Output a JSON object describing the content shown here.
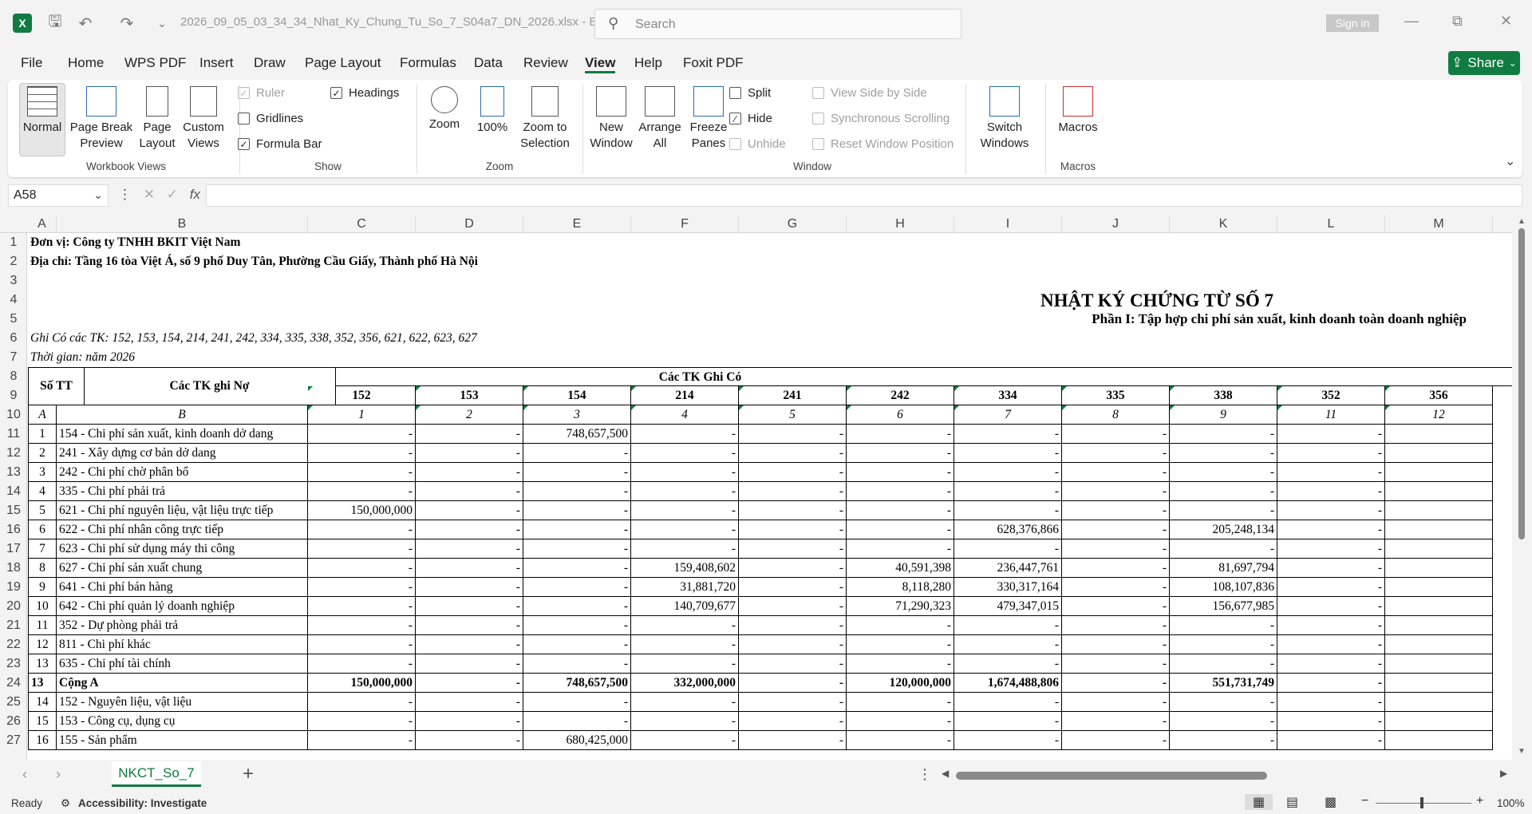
{
  "titlebar": {
    "filename": "2026_09_05_03_34_34_Nhat_Ky_Chung_Tu_So_7_S04a7_DN_2026.xlsx  -  E...",
    "search_placeholder": "Search",
    "signin": "Sign in"
  },
  "menu": [
    "File",
    "Home",
    "WPS PDF",
    "Insert",
    "Draw",
    "Page Layout",
    "Formulas",
    "Data",
    "Review",
    "View",
    "Help",
    "Foxit PDF"
  ],
  "active_menu": "View",
  "share_label": "Share",
  "ribbon": {
    "workbook_views": {
      "label": "Workbook Views",
      "items": [
        "Normal",
        "Page Break Preview",
        "Page Layout",
        "Custom Views"
      ]
    },
    "show": {
      "label": "Show",
      "ruler": "Ruler",
      "gridlines": "Gridlines",
      "formula_bar": "Formula Bar",
      "headings": "Headings"
    },
    "zoom": {
      "label": "Zoom",
      "items": [
        "Zoom",
        "100%",
        "Zoom to Selection"
      ]
    },
    "window": {
      "label": "Window",
      "new_window": "New Window",
      "arrange_all": "Arrange All",
      "freeze_panes": "Freeze Panes",
      "split": "Split",
      "hide": "Hide",
      "unhide": "Unhide",
      "view_side_by_side": "View Side by Side",
      "sync_scrolling": "Synchronous Scrolling",
      "reset_position": "Reset Window Position",
      "switch_windows": "Switch Windows"
    },
    "macros": {
      "label": "Macros",
      "item": "Macros"
    }
  },
  "formula_bar": {
    "name_box": "A58",
    "fx": "fx",
    "value": ""
  },
  "columns": [
    "A",
    "B",
    "C",
    "D",
    "E",
    "F",
    "G",
    "H",
    "I",
    "J",
    "K",
    "L",
    "M"
  ],
  "rows": [
    "1",
    "2",
    "3",
    "4",
    "5",
    "6",
    "7",
    "8",
    "9",
    "10",
    "11",
    "12",
    "13",
    "14",
    "15",
    "16",
    "17",
    "18",
    "19",
    "20",
    "21",
    "22",
    "23",
    "24",
    "25",
    "26",
    "27"
  ],
  "sheet": {
    "unit": "Đơn vị: Công ty TNHH BKIT Việt Nam",
    "address": "Địa chỉ: Tầng 16 tòa Việt Á, số 9 phố Duy Tân, Phường Cầu Giấy, Thành phố Hà Nội",
    "title": "NHẬT KÝ CHỨNG TỪ SỐ 7",
    "subtitle": "Phần I: Tập hợp chi phí sản xuất, kinh doanh toàn doanh nghiệp",
    "ghi_co": "Ghi Có các TK: 152, 153, 154, 214, 241, 242, 334, 335, 338, 352, 356, 621, 622, 623, 627",
    "thoi_gian": "Thời gian: năm 2026",
    "hdr_stt": "Số TT",
    "hdr_tk_no": "Các TK ghi Nợ",
    "hdr_tk_co": "Các TK Ghi Có",
    "acct_cols": [
      "152",
      "153",
      "154",
      "214",
      "241",
      "242",
      "334",
      "335",
      "338",
      "352",
      "356"
    ],
    "letter_a": "A",
    "letter_b": "B",
    "col_nums": [
      "1",
      "2",
      "3",
      "4",
      "5",
      "6",
      "7",
      "8",
      "9",
      "11",
      "12"
    ],
    "data_rows": [
      {
        "stt": "1",
        "name": "154 - Chi phí sản xuất, kinh doanh dở dang",
        "v": [
          "-",
          "-",
          "748,657,500",
          "-",
          "-",
          "-",
          "-",
          "-",
          "-",
          "-",
          ""
        ]
      },
      {
        "stt": "2",
        "name": "241 - Xây dựng cơ bản dở dang",
        "v": [
          "-",
          "-",
          "-",
          "-",
          "-",
          "-",
          "-",
          "-",
          "-",
          "-",
          ""
        ]
      },
      {
        "stt": "3",
        "name": "242 - Chi phí chờ phân bổ",
        "v": [
          "-",
          "-",
          "-",
          "-",
          "-",
          "-",
          "-",
          "-",
          "-",
          "-",
          ""
        ]
      },
      {
        "stt": "4",
        "name": "335 - Chi phí phải trả",
        "v": [
          "-",
          "-",
          "-",
          "-",
          "-",
          "-",
          "-",
          "-",
          "-",
          "-",
          ""
        ]
      },
      {
        "stt": "5",
        "name": "621 - Chi phí nguyên liệu, vật liệu trực tiếp",
        "v": [
          "150,000,000",
          "-",
          "-",
          "-",
          "-",
          "-",
          "-",
          "-",
          "-",
          "-",
          ""
        ]
      },
      {
        "stt": "6",
        "name": "622 - Chi phí nhân công trực tiếp",
        "v": [
          "-",
          "-",
          "-",
          "-",
          "-",
          "-",
          "628,376,866",
          "-",
          "205,248,134",
          "-",
          ""
        ]
      },
      {
        "stt": "7",
        "name": "623 - Chi phí sử dụng máy thi công",
        "v": [
          "-",
          "-",
          "-",
          "-",
          "-",
          "-",
          "-",
          "-",
          "-",
          "-",
          ""
        ]
      },
      {
        "stt": "8",
        "name": "627 - Chi phí sản xuất chung",
        "v": [
          "-",
          "-",
          "-",
          "159,408,602",
          "-",
          "40,591,398",
          "236,447,761",
          "-",
          "81,697,794",
          "-",
          ""
        ]
      },
      {
        "stt": "9",
        "name": "641 - Chi phí bán hàng",
        "v": [
          "-",
          "-",
          "-",
          "31,881,720",
          "-",
          "8,118,280",
          "330,317,164",
          "-",
          "108,107,836",
          "-",
          ""
        ]
      },
      {
        "stt": "10",
        "name": "642 - Chi phí quản lý doanh nghiệp",
        "v": [
          "-",
          "-",
          "-",
          "140,709,677",
          "-",
          "71,290,323",
          "479,347,015",
          "-",
          "156,677,985",
          "-",
          ""
        ]
      },
      {
        "stt": "11",
        "name": "352 - Dự phòng phải trả",
        "v": [
          "-",
          "-",
          "-",
          "-",
          "-",
          "-",
          "-",
          "-",
          "-",
          "-",
          ""
        ]
      },
      {
        "stt": "12",
        "name": "811 - Chi phí khác",
        "v": [
          "-",
          "-",
          "-",
          "-",
          "-",
          "-",
          "-",
          "-",
          "-",
          "-",
          ""
        ]
      },
      {
        "stt": "13",
        "name": "635 - Chi phí tài chính",
        "v": [
          "-",
          "-",
          "-",
          "-",
          "-",
          "-",
          "-",
          "-",
          "-",
          "-",
          ""
        ]
      },
      {
        "stt": "13",
        "name": "Cộng A",
        "total": true,
        "v": [
          "150,000,000",
          "-",
          "748,657,500",
          "332,000,000",
          "-",
          "120,000,000",
          "1,674,488,806",
          "-",
          "551,731,749",
          "-",
          ""
        ]
      },
      {
        "stt": "14",
        "name": "152 - Nguyên liệu, vật liệu",
        "v": [
          "-",
          "-",
          "-",
          "-",
          "-",
          "-",
          "-",
          "-",
          "-",
          "-",
          ""
        ]
      },
      {
        "stt": "15",
        "name": "153 - Công cụ, dụng cụ",
        "v": [
          "-",
          "-",
          "-",
          "-",
          "-",
          "-",
          "-",
          "-",
          "-",
          "-",
          ""
        ]
      },
      {
        "stt": "16",
        "name": "155 - Sản phẩm",
        "v": [
          "-",
          "-",
          "680,425,000",
          "-",
          "-",
          "-",
          "-",
          "-",
          "-",
          "-",
          ""
        ]
      }
    ]
  },
  "sheet_tab": "NKCT_So_7",
  "status": {
    "ready": "Ready",
    "accessibility": "Accessibility: Investigate",
    "zoom": "100%"
  }
}
